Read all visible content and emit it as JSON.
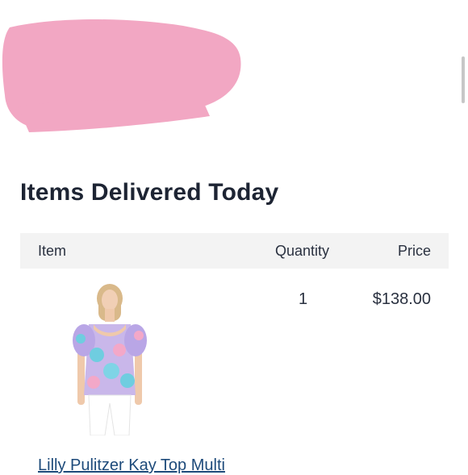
{
  "section": {
    "title": "Items Delivered Today"
  },
  "table": {
    "headers": {
      "item": "Item",
      "quantity": "Quantity",
      "price": "Price"
    },
    "rows": [
      {
        "product_name": "Lilly Pulitzer Kay Top Multi",
        "quantity": "1",
        "price": "$138.00"
      }
    ]
  },
  "colors": {
    "redaction": "#f2a7c3",
    "header_bg": "#f3f3f3",
    "link": "#1d4a7a"
  }
}
